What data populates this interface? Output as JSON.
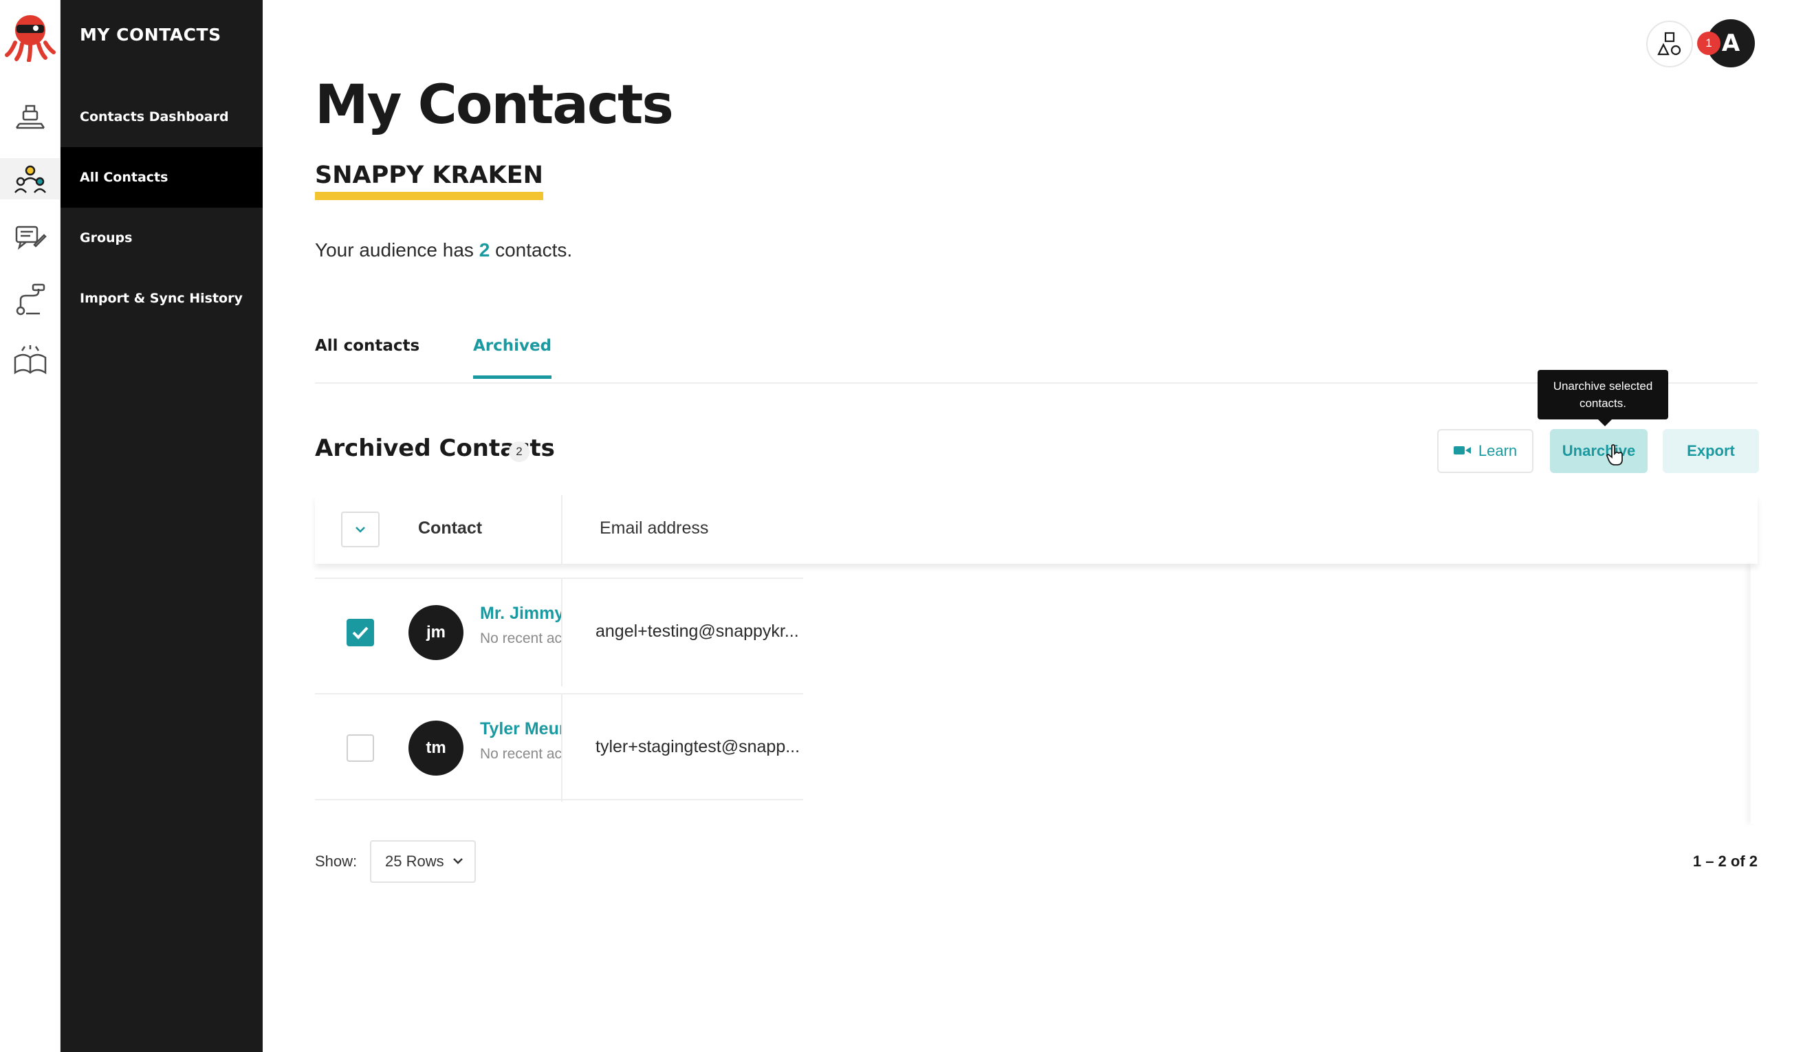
{
  "sidebar": {
    "title": "MY CONTACTS",
    "items": [
      {
        "label": "Contacts Dashboard",
        "active": false
      },
      {
        "label": "All Contacts",
        "active": true
      },
      {
        "label": "Groups",
        "active": false
      },
      {
        "label": "Import & Sync History",
        "active": false
      }
    ]
  },
  "rail": {
    "icons": [
      "kraken-logo-icon",
      "dashboard-stack-icon",
      "contacts-people-icon",
      "campaigns-chat-icon",
      "automation-flow-icon",
      "learning-book-icon"
    ]
  },
  "header": {
    "title": "My Contacts",
    "org_name": "SNAPPY KRAKEN",
    "audience_prefix": "Your audience has",
    "audience_count": "2",
    "audience_suffix": "contacts."
  },
  "tabs": [
    {
      "label": "All contacts",
      "active": false
    },
    {
      "label": "Archived",
      "active": true
    }
  ],
  "section": {
    "title": "Archived Contacts",
    "count": "2"
  },
  "actions": {
    "learn_label": "Learn",
    "unarchive_label": "Unarchive",
    "export_label": "Export",
    "tooltip": "Unarchive selected contacts."
  },
  "table": {
    "columns": [
      "Contact",
      "Email address"
    ],
    "rows": [
      {
        "checked": true,
        "initials": "jm",
        "name": "Mr. Jimmy",
        "activity": "No recent activity",
        "email": "angel+testing@snappykr..."
      },
      {
        "checked": false,
        "initials": "tm",
        "name": "Tyler Meur",
        "activity": "No recent activity",
        "email": "tyler+stagingtest@snapp..."
      }
    ]
  },
  "footer": {
    "show_label": "Show:",
    "rows_option": "25 Rows",
    "pagination": "1 – 2 of 2"
  },
  "topbar": {
    "notification_count": "1",
    "user_initial": "A"
  },
  "colors": {
    "accent": "#1a9aa0",
    "sidebar_bg": "#1b1b1b",
    "highlight_yellow": "#f4c430",
    "notification_red": "#e53935"
  }
}
